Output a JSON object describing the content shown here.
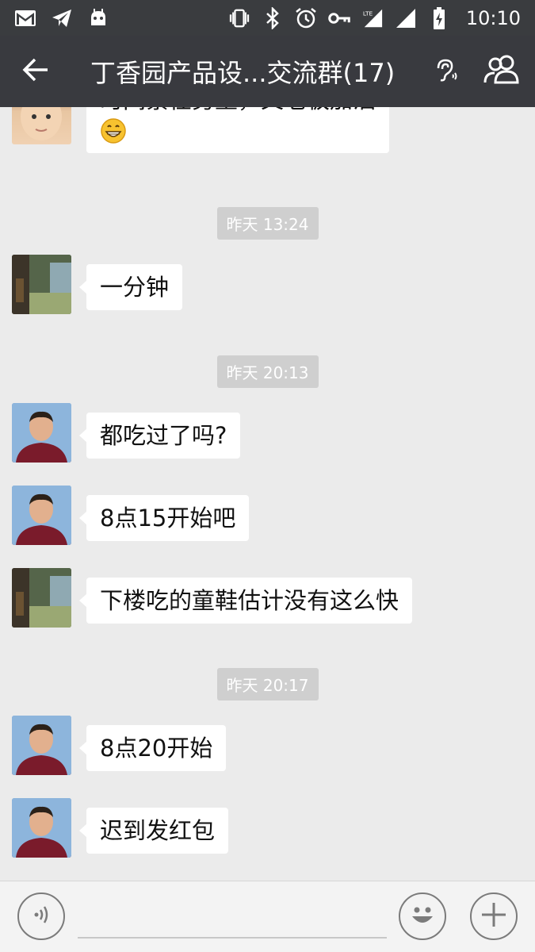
{
  "status_bar": {
    "time": "10:10",
    "network": "LTE",
    "icons": [
      "gmail-icon",
      "telegram-icon",
      "android-icon",
      "vibrate-icon",
      "bluetooth-icon",
      "alarm-icon",
      "vpn-key-icon",
      "signal-lte-icon",
      "signal-icon",
      "battery-charging-icon"
    ]
  },
  "app_bar": {
    "title": "丁香园产品设...交流群(17)",
    "icons": [
      "back-arrow-icon",
      "earpiece-icon",
      "group-members-icon"
    ]
  },
  "messages": [
    {
      "type": "message",
      "sender_avatar": "baby",
      "text": "时间紧任务重，又老板加油",
      "emoji": "grinning-emoji"
    },
    {
      "type": "timestamp",
      "text": "昨天 13:24"
    },
    {
      "type": "message",
      "sender_avatar": "garden",
      "text": "一分钟"
    },
    {
      "type": "timestamp",
      "text": "昨天 20:13"
    },
    {
      "type": "message",
      "sender_avatar": "man",
      "text": "都吃过了吗?"
    },
    {
      "type": "message",
      "sender_avatar": "man",
      "text": "8点15开始吧"
    },
    {
      "type": "message",
      "sender_avatar": "garden",
      "text": "下楼吃的童鞋估计没有这么快"
    },
    {
      "type": "timestamp",
      "text": "昨天 20:17"
    },
    {
      "type": "message",
      "sender_avatar": "man",
      "text": "8点20开始"
    },
    {
      "type": "message",
      "sender_avatar": "man",
      "text": "迟到发红包"
    }
  ],
  "input_bar": {
    "value": "",
    "icons": [
      "voice-input-icon",
      "emoji-icon",
      "plus-icon"
    ]
  },
  "colors": {
    "status_bar": "#3a3c3f",
    "app_bar": "#393a3f",
    "chat_background": "#ebebeb",
    "bubble": "#ffffff",
    "timestamp_pill": "#cfcfcf"
  }
}
